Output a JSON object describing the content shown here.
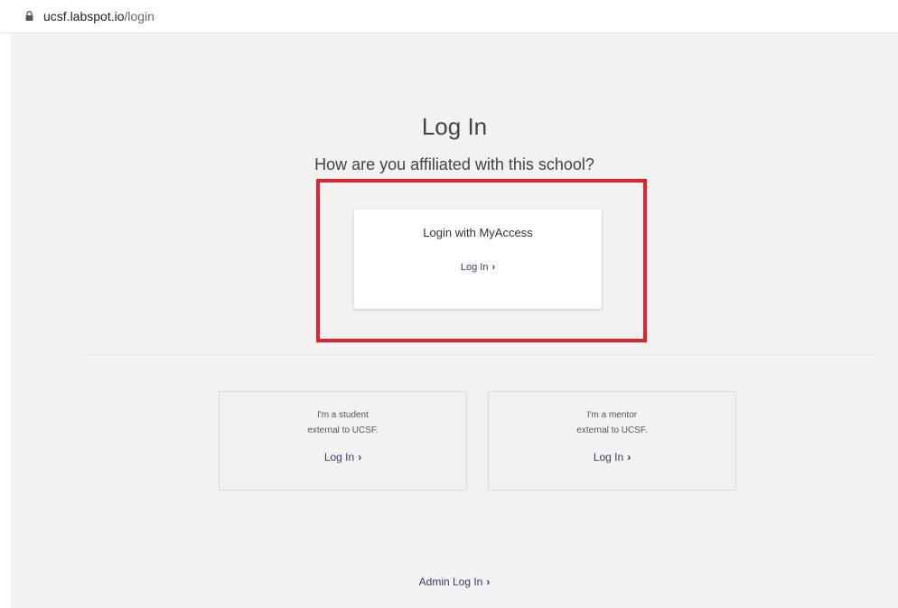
{
  "browser": {
    "url_host": "ucsf.labspot.io",
    "url_path": "/login"
  },
  "page": {
    "title": "Log In",
    "subtitle": "How are you affiliated with this school?"
  },
  "primary_card": {
    "heading": "Login with MyAccess",
    "link_label": "Log In"
  },
  "student_card": {
    "line1": "I'm a student",
    "line2": "external to UCSF.",
    "link_label": "Log In"
  },
  "mentor_card": {
    "line1": "I'm a mentor",
    "line2": "external to UCSF.",
    "link_label": "Log In"
  },
  "admin": {
    "link_label": "Admin Log In"
  },
  "icons": {
    "lock": "lock-icon",
    "chevron": "chevron-right-icon"
  },
  "colors": {
    "highlight_border": "#e0232b",
    "link": "#3b3a6a",
    "page_background": "#f2f2f2"
  }
}
